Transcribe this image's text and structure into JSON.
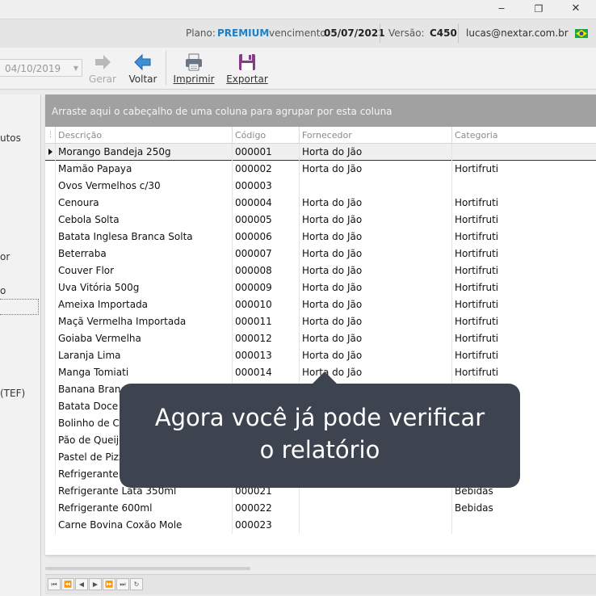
{
  "window": {
    "controls": [
      "‒",
      "❐",
      "✕"
    ]
  },
  "infobar": {
    "plan_label": "Plano:",
    "plan_value": "PREMIUM",
    "due_label": "vencimento",
    "due_value": "05/07/2021",
    "version_label": "Versão:",
    "version_value": "C450",
    "user_email": "lucas@nextar.com.br",
    "accent_color": "#1f7fc4"
  },
  "toolbar": {
    "date_value": "04/10/2019",
    "buttons": {
      "gerar": "Gerar",
      "voltar": "Voltar",
      "imprimir": "Imprimir",
      "exportar": "Exportar"
    }
  },
  "sidebar": {
    "items": [
      "utos",
      "or",
      "o",
      "(TEF)"
    ]
  },
  "grid": {
    "group_hint": "Arraste aqui o cabeçalho de uma coluna para agrupar por esta coluna",
    "columns": [
      "Descrição",
      "Código",
      "Fornecedor",
      "Categoria"
    ],
    "rows": [
      {
        "descricao": "Morango Bandeja 250g",
        "codigo": "000001",
        "fornecedor": "Horta do Jão",
        "categoria": ""
      },
      {
        "descricao": "Mamão Papaya",
        "codigo": "000002",
        "fornecedor": "Horta do Jão",
        "categoria": "Hortifruti"
      },
      {
        "descricao": "Ovos Vermelhos c/30",
        "codigo": "000003",
        "fornecedor": "",
        "categoria": ""
      },
      {
        "descricao": "Cenoura",
        "codigo": "000004",
        "fornecedor": "Horta do Jão",
        "categoria": "Hortifruti"
      },
      {
        "descricao": "Cebola Solta",
        "codigo": "000005",
        "fornecedor": "Horta do Jão",
        "categoria": "Hortifruti"
      },
      {
        "descricao": "Batata Inglesa Branca Solta",
        "codigo": "000006",
        "fornecedor": "Horta do Jão",
        "categoria": "Hortifruti"
      },
      {
        "descricao": "Beterraba",
        "codigo": "000007",
        "fornecedor": "Horta do Jão",
        "categoria": "Hortifruti"
      },
      {
        "descricao": "Couver Flor",
        "codigo": "000008",
        "fornecedor": "Horta do Jão",
        "categoria": "Hortifruti"
      },
      {
        "descricao": "Uva Vitória 500g",
        "codigo": "000009",
        "fornecedor": "Horta do Jão",
        "categoria": "Hortifruti"
      },
      {
        "descricao": "Ameixa Importada",
        "codigo": "000010",
        "fornecedor": "Horta do Jão",
        "categoria": "Hortifruti"
      },
      {
        "descricao": "Maçã Vermelha Importada",
        "codigo": "000011",
        "fornecedor": "Horta do Jão",
        "categoria": "Hortifruti"
      },
      {
        "descricao": "Goiaba Vermelha",
        "codigo": "000012",
        "fornecedor": "Horta do Jão",
        "categoria": "Hortifruti"
      },
      {
        "descricao": "Laranja Lima",
        "codigo": "000013",
        "fornecedor": "Horta do Jão",
        "categoria": "Hortifruti"
      },
      {
        "descricao": "Manga Tomiati",
        "codigo": "000014",
        "fornecedor": "Horta do Jão",
        "categoria": "Hortifruti"
      },
      {
        "descricao": "Banana Branca",
        "codigo": "",
        "fornecedor": "",
        "categoria": ""
      },
      {
        "descricao": "Batata Doce",
        "codigo": "",
        "fornecedor": "",
        "categoria": ""
      },
      {
        "descricao": "Bolinho de Ch",
        "codigo": "",
        "fornecedor": "",
        "categoria": ""
      },
      {
        "descricao": "Pão de Queijo",
        "codigo": "",
        "fornecedor": "",
        "categoria": ""
      },
      {
        "descricao": "Pastel de Pizz",
        "codigo": "",
        "fornecedor": "",
        "categoria": ""
      },
      {
        "descricao": "Refrigerante 2",
        "codigo": "",
        "fornecedor": "",
        "categoria": ""
      },
      {
        "descricao": "Refrigerante Lata 350ml",
        "codigo": "000021",
        "fornecedor": "",
        "categoria": "Bebidas"
      },
      {
        "descricao": "Refrigerante 600ml",
        "codigo": "000022",
        "fornecedor": "",
        "categoria": "Bebidas"
      },
      {
        "descricao": "Carne Bovina Coxão Mole",
        "codigo": "000023",
        "fornecedor": "",
        "categoria": ""
      }
    ]
  },
  "tooltip": {
    "line1": "Agora você já pode verificar",
    "line2": "o relatório"
  },
  "icons": {
    "gerar": "arrow-right-icon",
    "voltar": "arrow-left-icon",
    "imprimir": "printer-icon",
    "exportar": "floppy-disk-icon",
    "brazil_flag": "brazil-flag-icon"
  }
}
